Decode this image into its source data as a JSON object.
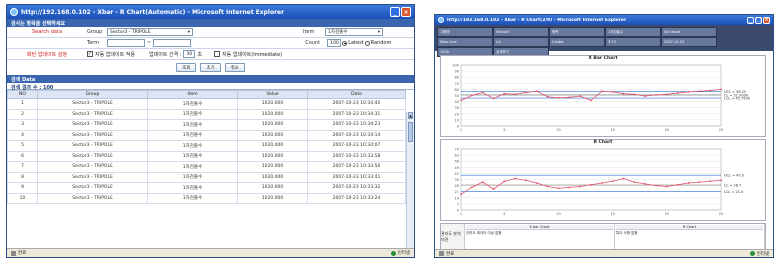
{
  "win1": {
    "title": "http://192.168.0.102 - Xbar - R Chart(Automatic) - Microsoft Internet Explorer",
    "panel_title": "검사는 항목을 선택하세요",
    "search_label": "Search data",
    "group_label": "Group",
    "group_value": "Sector3 - TRIPOLE",
    "item_label": "Item",
    "item_value": "1차검출수",
    "term_label": "Term",
    "count_label": "Count",
    "count_value": "100",
    "radio_latest": "Latest",
    "radio_random": "Random",
    "update_label": "패턴 업데이트 설정",
    "auto_update": "자동 업데이트 적용",
    "interval_label": "업데이트 간격 :",
    "interval_value": "30",
    "interval_unit": "초",
    "manual_update": "자동 업데이트(Immediate)",
    "buttons": [
      "조회",
      "초기",
      "취소"
    ],
    "data_title": "검색 Data",
    "result_count": "검색 결과 수 : 100",
    "columns": [
      "NO",
      "Group",
      "Item",
      "Value",
      "Date"
    ],
    "rows": [
      [
        "1",
        "Sector3 - TRIPOLE",
        "1차검출수",
        "1020.000",
        "2007-10-23 10:34:40"
      ],
      [
        "2",
        "Sector3 - TRIPOLE",
        "1차검출수",
        "1020.000",
        "2007-10-23 10:34:31"
      ],
      [
        "3",
        "Sector3 - TRIPOLE",
        "1차검출수",
        "1020.000",
        "2007-10-23 10:34:23"
      ],
      [
        "4",
        "Sector3 - TRIPOLE",
        "1차검출수",
        "1020.000",
        "2007-10-23 10:34:14"
      ],
      [
        "5",
        "Sector3 - TRIPOLE",
        "1차검출수",
        "1020.000",
        "2007-10-23 10:34:07"
      ],
      [
        "6",
        "Sector3 - TRIPOLE",
        "1차검출수",
        "1020.000",
        "2007-10-23 10:33:58"
      ],
      [
        "7",
        "Sector3 - TRIPOLE",
        "1차검출수",
        "1020.000",
        "2007-10-23 10:33:50"
      ],
      [
        "8",
        "Sector3 - TRIPOLE",
        "1차검출수",
        "1020.000",
        "2007-10-23 10:33:41"
      ],
      [
        "9",
        "Sector3 - TRIPOLE",
        "1차검출수",
        "1020.000",
        "2007-10-23 10:33:32"
      ],
      [
        "10",
        "Sector3 - TRIPOLE",
        "1차검출수",
        "1020.000",
        "2007-10-23 10:33:24"
      ]
    ],
    "status_left": "완료",
    "status_right": "인터넷"
  },
  "win2": {
    "title": "http://192.168.0.102 - Xbar - R Chart(2/9) - Microsoft Internet Explorer",
    "tabs": [
      "그룹명",
      "Sector3",
      "항목",
      "1차검출수",
      "Ucl Value",
      "Xbar Line",
      "Lcl",
      "Center",
      "3.73",
      "2007-10-23",
      "1020",
      "상세보기"
    ],
    "chart1_title": "X Bar Chart",
    "chart2_title": "R Chart",
    "footer_label": "관리도 분석 의견",
    "footer_col1_head": "X bar Chart",
    "footer_col1_text": "관리도 데이터 이상 없음",
    "footer_col2_head": "R Chart",
    "footer_col2_text": "특이 사항 없음",
    "status_left": "완료",
    "status_right": "인터넷"
  },
  "chart_data": [
    {
      "type": "line",
      "title": "X Bar Chart",
      "x": [
        1,
        2,
        3,
        4,
        5,
        6,
        7,
        8,
        9,
        10,
        11,
        12,
        13,
        14,
        15,
        16,
        17,
        18,
        19,
        20,
        21,
        22,
        23,
        24,
        25
      ],
      "series": [
        {
          "name": "",
          "values": [
            42,
            50,
            55,
            45,
            53,
            52,
            55,
            57,
            48,
            46,
            47,
            49,
            42,
            57,
            56,
            53,
            52,
            49,
            51,
            52,
            54,
            56,
            57,
            58,
            60
          ]
        }
      ],
      "reference_lines": [
        {
          "label": "UCL = 56.25 ",
          "value": 56.25
        },
        {
          "label": "CL = 51.0000",
          "value": 51.0
        },
        {
          "label": "LCL = 45.7500",
          "value": 45.75
        }
      ],
      "ylim": [
        0,
        100
      ],
      "xticks": [
        1,
        5,
        10,
        15,
        20,
        25
      ]
    },
    {
      "type": "line",
      "title": "R Chart",
      "x": [
        1,
        2,
        3,
        4,
        5,
        6,
        7,
        8,
        9,
        10,
        11,
        12,
        13,
        14,
        15,
        16,
        17,
        18,
        19,
        20,
        21,
        22,
        23,
        24,
        25
      ],
      "series": [
        {
          "name": "",
          "values": [
            18,
            26,
            32,
            24,
            33,
            36,
            34,
            31,
            27,
            25,
            26,
            27,
            29,
            31,
            33,
            36,
            32,
            30,
            28,
            27,
            29,
            31,
            32,
            33,
            34
          ]
        }
      ],
      "reference_lines": [
        {
          "label": "UCL = 40.0",
          "value": 40
        },
        {
          "label": "CL = 28.7",
          "value": 28.7
        },
        {
          "label": "LCL = 21.0",
          "value": 21
        }
      ],
      "ylim": [
        0,
        70
      ],
      "xticks": [
        1,
        5,
        10,
        15,
        20,
        25
      ]
    }
  ]
}
